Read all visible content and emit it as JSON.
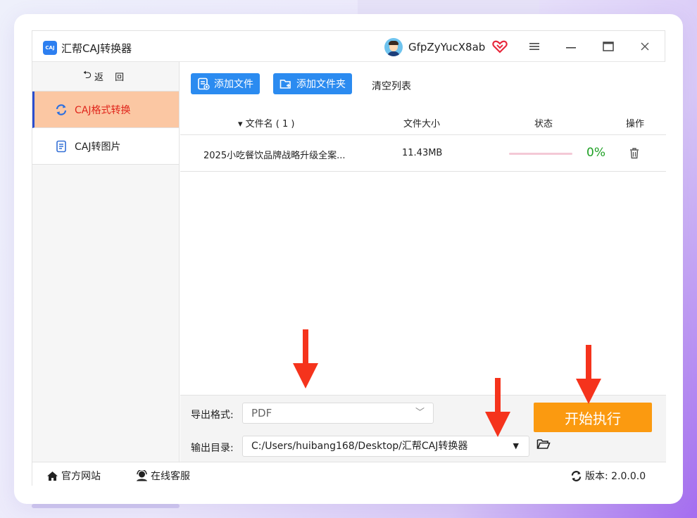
{
  "app": {
    "title": "汇帮CAJ转换器",
    "logo_text": "CAJ",
    "username": "GfpZyYucX8ab"
  },
  "window_controls": {
    "menu_icon": "hamburger-icon",
    "minimize_icon": "minimize-icon",
    "maximize_icon": "maximize-icon",
    "close_icon": "close-icon"
  },
  "sidebar": {
    "back_label": "返 回",
    "items": [
      {
        "label": "CAJ格式转换",
        "icon": "refresh-icon",
        "active": true
      },
      {
        "label": "CAJ转图片",
        "icon": "document-icon",
        "active": false
      }
    ]
  },
  "toolbar": {
    "add_file_label": "添加文件",
    "add_folder_label": "添加文件夹",
    "clear_label": "清空列表"
  },
  "table": {
    "headers": {
      "name": "▾ 文件名 ( 1 )",
      "size": "文件大小",
      "status": "状态",
      "action": "操作"
    },
    "rows": [
      {
        "name": "2025小吃餐饮品牌战略升级全案...",
        "size": "11.43MB",
        "progress": 0,
        "progress_text": "0%"
      }
    ]
  },
  "settings": {
    "format_label": "导出格式:",
    "format_value": "PDF",
    "dir_label": "输出目录:",
    "dir_value": "C:/Users/huibang168/Desktop/汇帮CAJ转换器",
    "start_label": "开始执行"
  },
  "footer": {
    "website_label": "官方网站",
    "service_label": "在线客服",
    "version_label": "版本: 2.0.0.0"
  },
  "colors": {
    "accent_blue": "#2b8bf0",
    "active_item_bg": "#fbc7a3",
    "active_item_text": "#e0251b",
    "start_button": "#fb9a10",
    "progress_text": "#1ea024",
    "annotation_arrow": "#f5331c"
  }
}
